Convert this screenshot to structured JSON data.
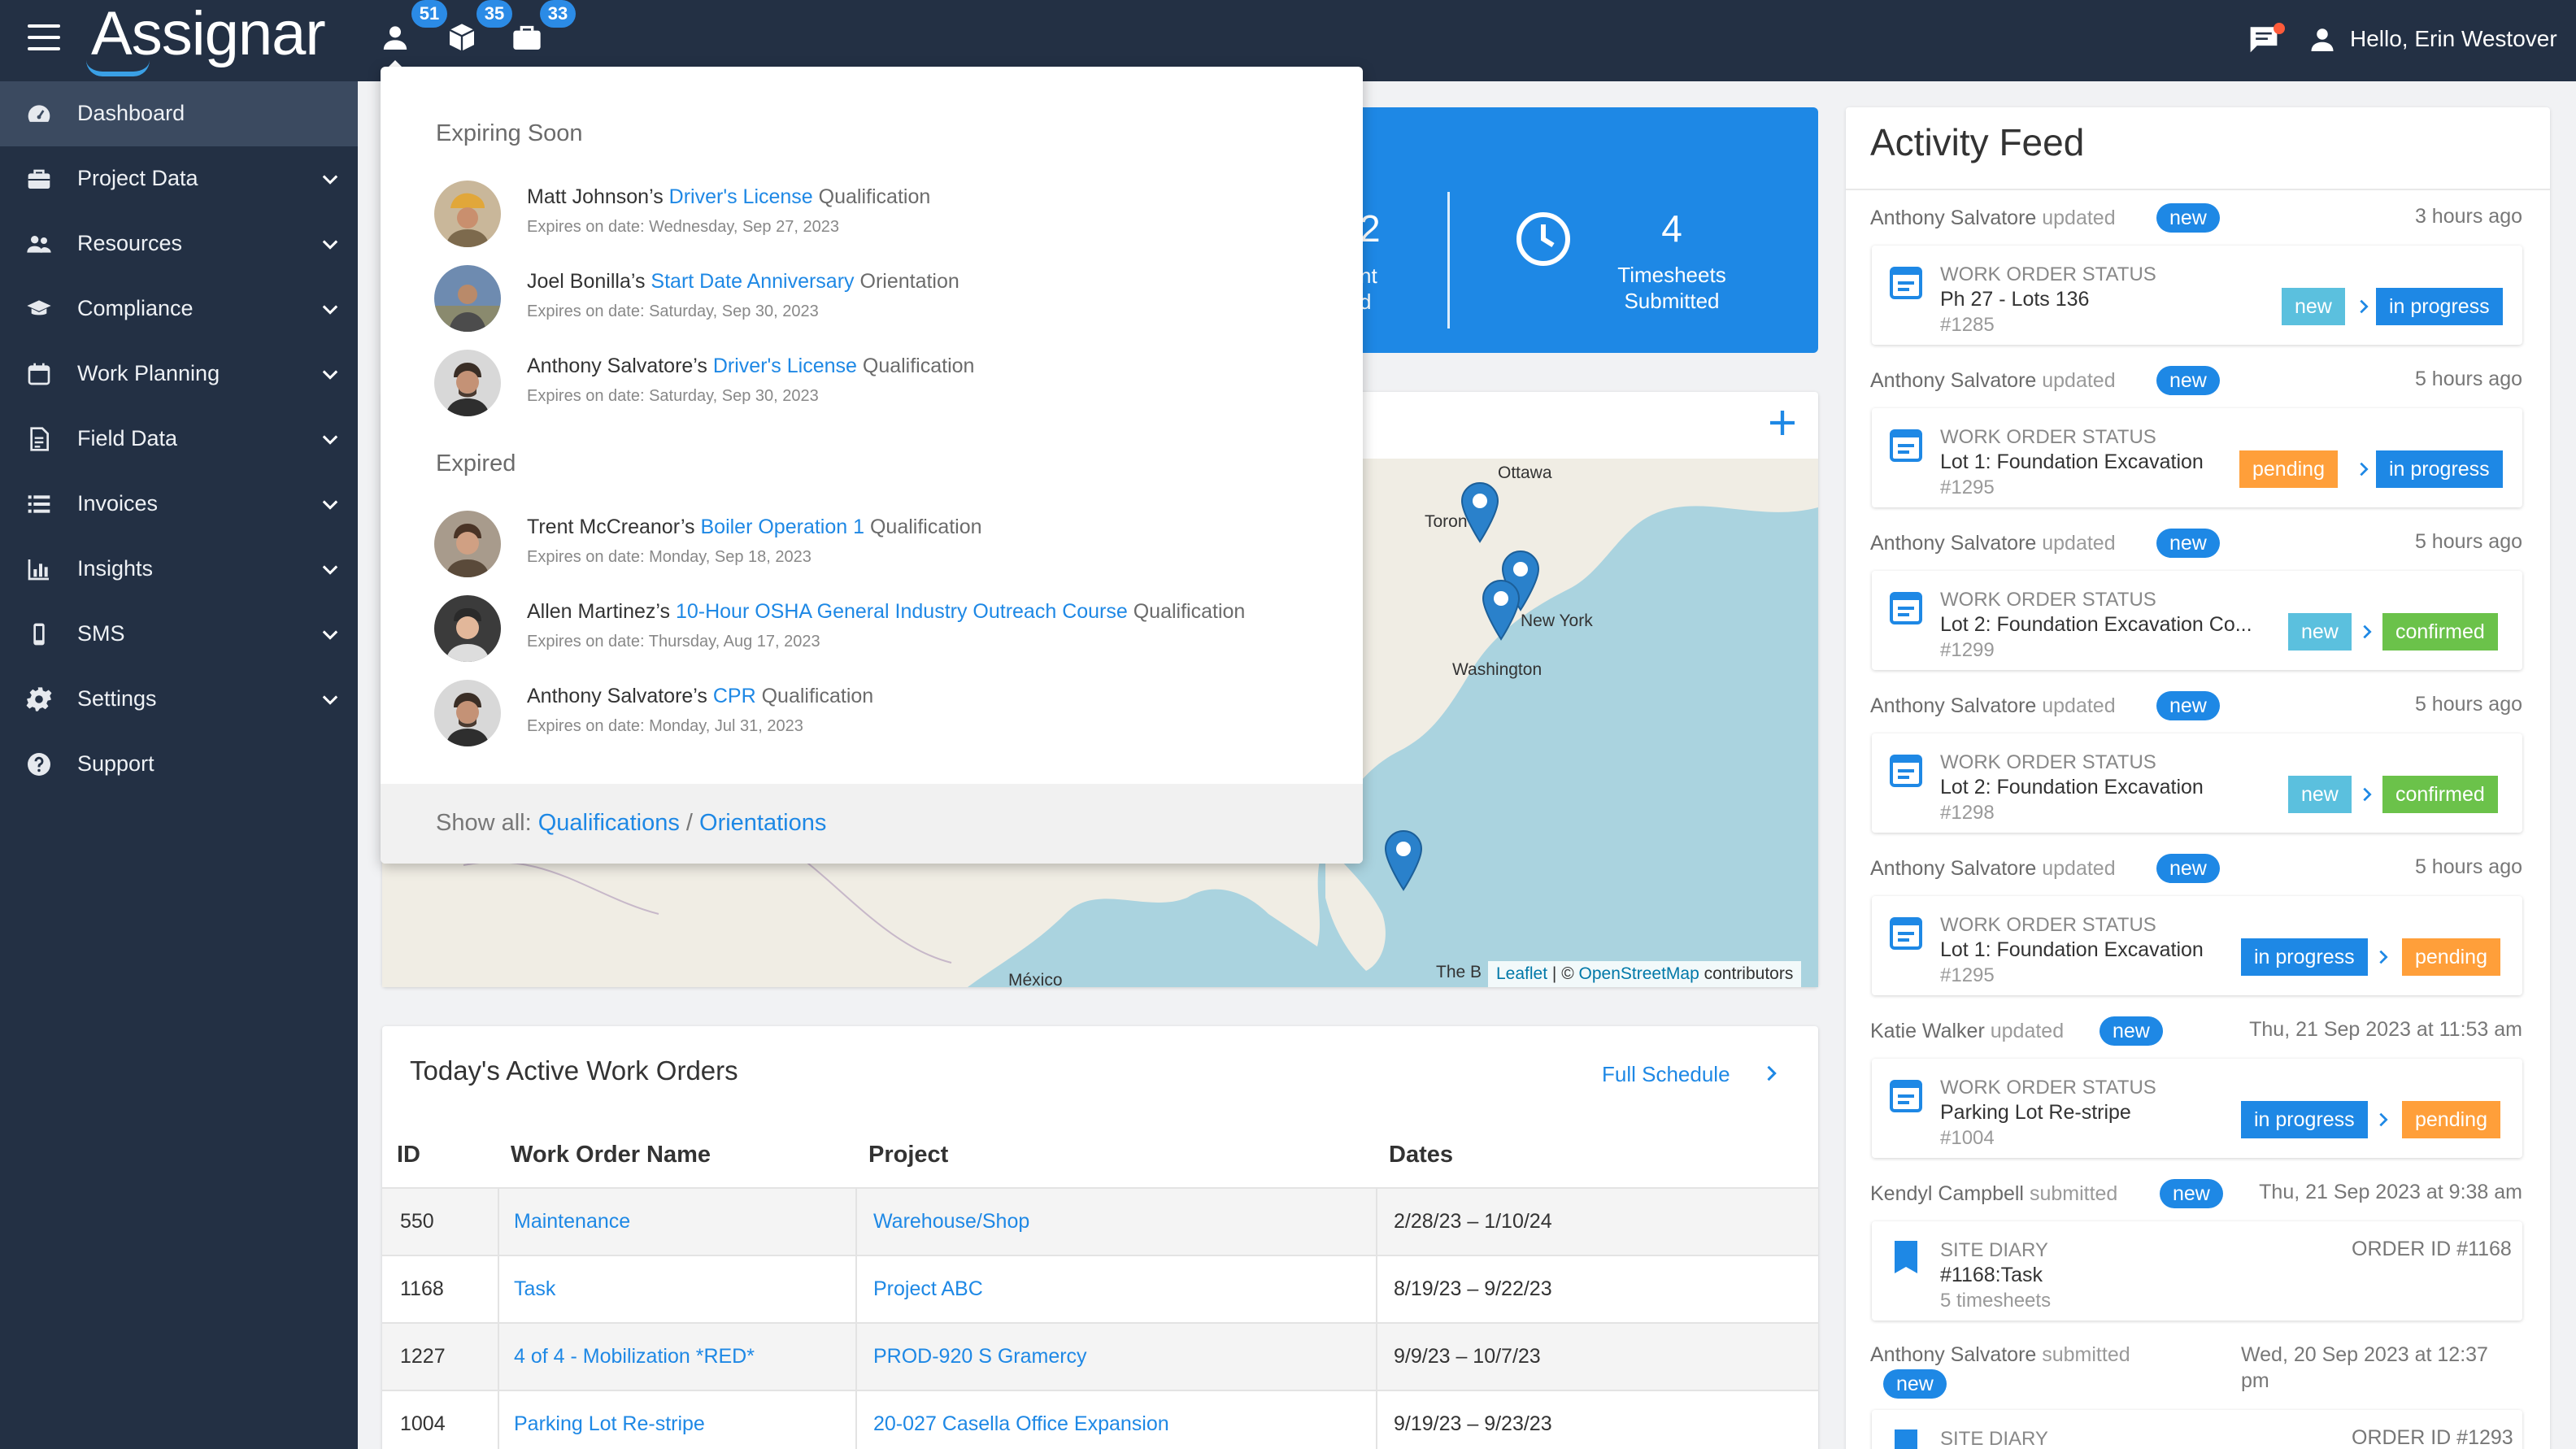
{
  "header": {
    "logo": "Assignar",
    "badges": [
      "51",
      "35",
      "33"
    ],
    "greeting": "Hello, Erin Westover"
  },
  "sidebar": {
    "items": [
      {
        "label": "Dashboard",
        "icon": "dashboard-icon"
      },
      {
        "label": "Project Data",
        "icon": "briefcase-icon"
      },
      {
        "label": "Resources",
        "icon": "users-icon"
      },
      {
        "label": "Compliance",
        "icon": "graduation-cap-icon"
      },
      {
        "label": "Work Planning",
        "icon": "calendar-icon"
      },
      {
        "label": "Field Data",
        "icon": "document-icon"
      },
      {
        "label": "Invoices",
        "icon": "list-icon"
      },
      {
        "label": "Insights",
        "icon": "bar-chart-icon"
      },
      {
        "label": "SMS",
        "icon": "mobile-icon"
      },
      {
        "label": "Settings",
        "icon": "gear-icon"
      },
      {
        "label": "Support",
        "icon": "help-icon"
      }
    ]
  },
  "stats": {
    "partial": {
      "num": "2",
      "line1": "nt",
      "line2": "d"
    },
    "timesheets": {
      "num": "4",
      "label1": "Timesheets",
      "label2": "Submitted"
    }
  },
  "dropdown": {
    "expiring_title": "Expiring Soon",
    "expired_title": "Expired",
    "expiring": [
      {
        "person": "Matt Johnson’s",
        "item": "Driver's License",
        "type": "Qualification",
        "date": "Expires on date: Wednesday, Sep 27, 2023"
      },
      {
        "person": "Joel Bonilla’s",
        "item": "Start Date Anniversary",
        "type": "Orientation",
        "date": "Expires on date: Saturday, Sep 30, 2023"
      },
      {
        "person": "Anthony Salvatore’s",
        "item": "Driver's License",
        "type": "Qualification",
        "date": "Expires on date: Saturday, Sep 30, 2023"
      }
    ],
    "expired": [
      {
        "person": "Trent McCreanor’s",
        "item": "Boiler Operation 1",
        "type": "Qualification",
        "date": "Expires on date: Monday, Sep 18, 2023"
      },
      {
        "person": "Allen Martinez’s",
        "item": "10-Hour OSHA General Industry Outreach Course",
        "type": "Qualification",
        "date": "Expires on date: Thursday, Aug 17, 2023"
      },
      {
        "person": "Anthony Salvatore’s",
        "item": "CPR",
        "type": "Qualification",
        "date": "Expires on date: Monday, Jul 31, 2023"
      }
    ],
    "footer_prefix": "Show all:",
    "footer_link1": "Qualifications",
    "footer_sep": "/",
    "footer_link2": "Orientations"
  },
  "map": {
    "labels": {
      "ottawa": "Ottawa",
      "toronto": "Toron",
      "newyork": "New York",
      "washington": "Washington",
      "mexico": "México",
      "bahamas": "The B"
    },
    "attribution_leaflet": "Leaflet",
    "attribution_sep": "| ©",
    "attribution_osm": "OpenStreetMap",
    "attribution_tail": "contributors"
  },
  "work_orders": {
    "title": "Today's Active Work Orders",
    "full_schedule": "Full Schedule",
    "columns": [
      "ID",
      "Work Order Name",
      "Project",
      "Dates"
    ],
    "rows": [
      {
        "id": "550",
        "name": "Maintenance",
        "project": "Warehouse/Shop",
        "dates": "2/28/23 – 1/10/24"
      },
      {
        "id": "1168",
        "name": "Task",
        "project": "Project ABC",
        "dates": "8/19/23 – 9/22/23"
      },
      {
        "id": "1227",
        "name": "4 of 4 - Mobilization *RED*",
        "project": "PROD-920 S Gramercy",
        "dates": "9/9/23 – 10/7/23"
      },
      {
        "id": "1004",
        "name": "Parking Lot Re-stripe",
        "project": "20-027 Casella Office Expansion",
        "dates": "9/19/23 – 9/23/23"
      }
    ]
  },
  "feed": {
    "title": "Activity Feed",
    "entries": [
      {
        "who": "Anthony Salvatore",
        "verb": "updated",
        "badge": "new",
        "time": "3 hours ago",
        "kind": "WORK ORDER STATUS",
        "name": "Ph 27 - Lots 136",
        "id": "#1285",
        "from": "new",
        "to": "in progress"
      },
      {
        "who": "Anthony Salvatore",
        "verb": "updated",
        "badge": "new",
        "time": "5 hours ago",
        "kind": "WORK ORDER STATUS",
        "name": "Lot 1: Foundation Excavation",
        "id": "#1295",
        "from": "pending",
        "to": "in progress"
      },
      {
        "who": "Anthony Salvatore",
        "verb": "updated",
        "badge": "new",
        "time": "5 hours ago",
        "kind": "WORK ORDER STATUS",
        "name": "Lot 2: Foundation Excavation Co...",
        "id": "#1299",
        "from": "new",
        "to": "confirmed"
      },
      {
        "who": "Anthony Salvatore",
        "verb": "updated",
        "badge": "new",
        "time": "5 hours ago",
        "kind": "WORK ORDER STATUS",
        "name": "Lot 2: Foundation Excavation",
        "id": "#1298",
        "from": "new",
        "to": "confirmed"
      },
      {
        "who": "Anthony Salvatore",
        "verb": "updated",
        "badge": "new",
        "time": "5 hours ago",
        "kind": "WORK ORDER STATUS",
        "name": "Lot 1: Foundation Excavation",
        "id": "#1295",
        "from": "in progress",
        "to": "pending"
      },
      {
        "who": "Katie Walker",
        "verb": "updated",
        "badge": "new",
        "time": "Thu, 21 Sep 2023 at 11:53 am",
        "kind": "WORK ORDER STATUS",
        "name": "Parking Lot Re-stripe",
        "id": "#1004",
        "from": "in progress",
        "to": "pending"
      },
      {
        "who": "Kendyl Campbell",
        "verb": "submitted",
        "badge": "new",
        "time": "Thu, 21 Sep 2023 at 9:38 am",
        "kind": "SITE DIARY",
        "name": "#1168:Task",
        "id": "5 timesheets",
        "order": "ORDER ID #1168"
      },
      {
        "who": "Anthony Salvatore",
        "verb": "submitted",
        "badge": "new",
        "time1": "Wed, 20 Sep 2023 at 12:37",
        "time2": "pm",
        "kind": "SITE DIARY",
        "order": "ORDER ID #1293"
      }
    ]
  },
  "colors": {
    "nav_bg": "#233044",
    "accent": "#1e88e5",
    "status_new": "#5bc0de",
    "status_in_progress": "#1e88e5",
    "status_pending": "#ff9f3a",
    "status_confirmed": "#6bc24a"
  }
}
